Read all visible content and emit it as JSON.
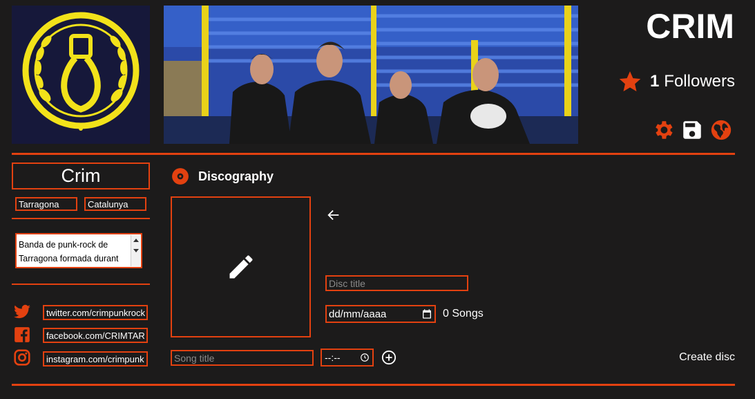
{
  "header": {
    "band_name": "CRIM",
    "followers_count": "1",
    "followers_label": "Followers",
    "actions": [
      {
        "icon": "gear-icon",
        "label": "settings"
      },
      {
        "icon": "save-icon",
        "label": "save"
      },
      {
        "icon": "globe-icon",
        "label": "web"
      }
    ]
  },
  "profile": {
    "name": "Crim",
    "city": "Tarragona",
    "region": "Catalunya",
    "bio": "Banda de punk-rock de Tarragona formada durant",
    "social": [
      {
        "icon": "twitter-icon",
        "value": "twitter.com/crimpunkrock"
      },
      {
        "icon": "facebook-icon",
        "value": "facebook.com/CRIMTAR"
      },
      {
        "icon": "instagram-icon",
        "value": "instagram.com/crimpunk"
      }
    ]
  },
  "discography": {
    "title": "Discography",
    "disc_title_placeholder": "Disc title",
    "date_placeholder": "dd/mm/aaaa",
    "songs_count": "0 Songs",
    "song_title_placeholder": "Song title",
    "duration_placeholder": "--:--",
    "create_label": "Create disc"
  },
  "colors": {
    "accent": "#e34110",
    "background": "#1c1b1b",
    "logo_yellow": "#f2e21a",
    "logo_bg": "#16183a"
  }
}
